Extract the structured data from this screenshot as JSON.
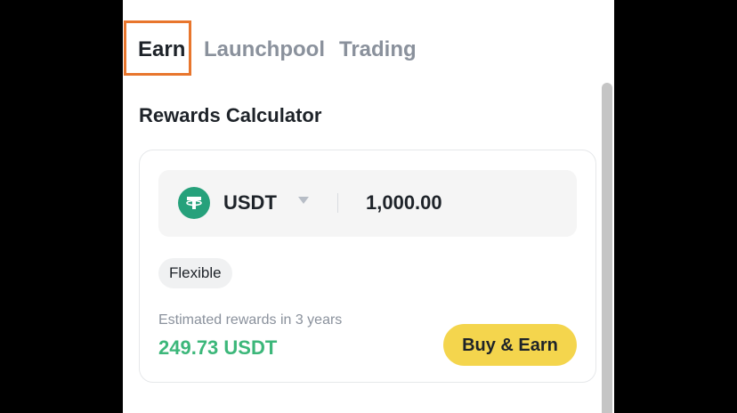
{
  "tabs": {
    "earn": "Earn",
    "launchpool": "Launchpool",
    "trading": "Trading",
    "active": "Earn"
  },
  "calculator": {
    "title": "Rewards Calculator",
    "coin": "USDT",
    "coin_icon": "tether-icon",
    "amount": "1,000.00",
    "term": "Flexible",
    "estimate_label": "Estimated rewards in 3 years",
    "estimate_value": "249.73 USDT",
    "cta": "Buy & Earn"
  },
  "colors": {
    "highlight": "#e8762d",
    "accent_green": "#3cb77a",
    "button_yellow": "#f4d54d",
    "coin_green": "#26a17b"
  }
}
